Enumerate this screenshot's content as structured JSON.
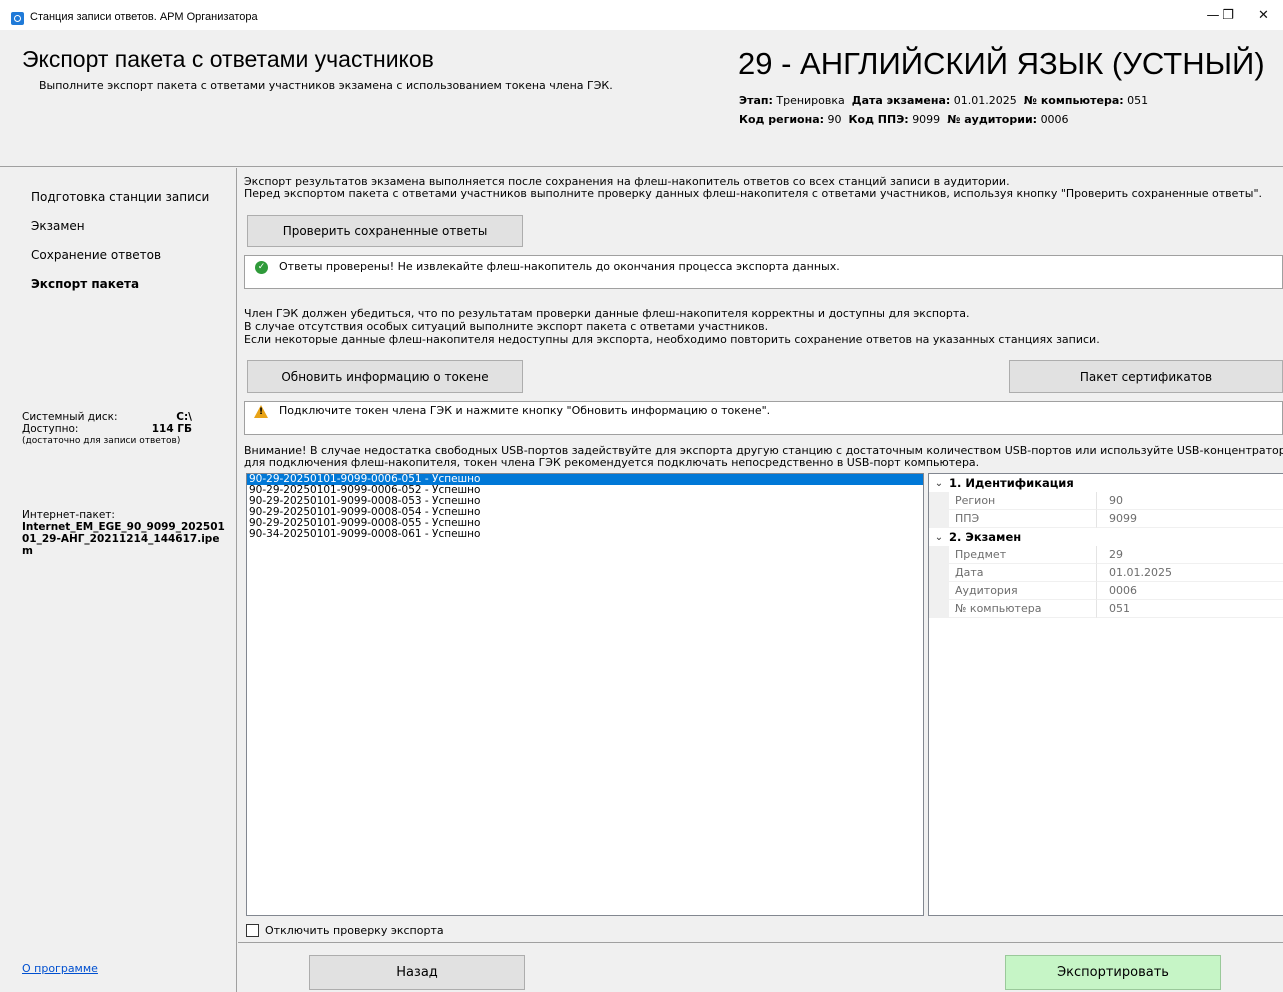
{
  "window": {
    "title": "Станция записи ответов. АРМ Организатора",
    "minimize_glyph": "—",
    "maximize_glyph": "❐",
    "close_glyph": "✕"
  },
  "header": {
    "title": "Экспорт пакета с ответами участников",
    "subtitle": "Выполните экспорт пакета с ответами участников экзамена с использованием токена члена ГЭК.",
    "subject": "29 - АНГЛИЙСКИЙ ЯЗЫК (УСТНЫЙ)",
    "stage_label": "Этап:",
    "stage_value": "Тренировка",
    "exam_date_label": "Дата экзамена:",
    "exam_date_value": "01.01.2025",
    "computer_label": "№ компьютера:",
    "computer_value": "051",
    "region_label": "Код региона:",
    "region_value": "90",
    "ppe_label": "Код ППЭ:",
    "ppe_value": "9099",
    "room_label": "№ аудитории:",
    "room_value": "0006"
  },
  "nav": {
    "items": [
      {
        "label": "Подготовка станции записи",
        "active": false
      },
      {
        "label": "Экзамен",
        "active": false
      },
      {
        "label": "Сохранение ответов",
        "active": false
      },
      {
        "label": "Экспорт пакета",
        "active": true
      }
    ]
  },
  "system": {
    "disk_label": "Системный диск:",
    "disk_value": "C:\\",
    "free_label": "Доступно:",
    "free_value": "114 ГБ",
    "free_note": "(достаточно для записи ответов)",
    "package_label": "Интернет-пакет:",
    "package_value": "Internet_EM_EGE_90_9099_20250101_29-АНГ_20211214_144617.ipem",
    "about_link": "О программе"
  },
  "main": {
    "intro_line1": "Экспорт результатов экзамена выполняется после сохранения на флеш-накопитель ответов со всех станций записи в аудитории.",
    "intro_line2": "Перед экспортом пакета с ответами участников выполните проверку данных флеш-накопителя с ответами участников, используя кнопку \"Проверить сохраненные ответы\".",
    "check_button": "Проверить сохраненные ответы",
    "check_status": "Ответы проверены! Не извлекайте флеш-накопитель до окончания процесса экспорта данных.",
    "gek_line1": "Член ГЭК должен убедиться, что по результатам проверки данные флеш-накопителя корректны и доступны для экспорта.",
    "gek_line2": "В случае отсутствия особых ситуаций выполните экспорт пакета с ответами участников.",
    "gek_line3": "Если некоторые данные флеш-накопителя недоступны для экспорта, необходимо повторить сохранение ответов на указанных станциях записи.",
    "refresh_token_button": "Обновить информацию о токене",
    "certificates_button": "Пакет сертификатов",
    "token_status": "Подключите токен члена ГЭК и нажмите кнопку \"Обновить информацию о токене\".",
    "warning_line1": "Внимание! В случае недостатка свободных USB-портов задействуйте для экспорта другую станцию с достаточным количеством USB-портов или используйте USB-концентратор",
    "warning_line2": "для подключения флеш-накопителя, токен члена ГЭК рекомендуется подключать непосредственно в USB-порт компьютера.",
    "files": [
      "90-29-20250101-9099-0006-051 - Успешно",
      "90-29-20250101-9099-0006-052 - Успешно",
      "90-29-20250101-9099-0008-053 - Успешно",
      "90-29-20250101-9099-0008-054 - Успешно",
      "90-29-20250101-9099-0008-055 - Успешно",
      "90-34-20250101-9099-0008-061 - Успешно"
    ],
    "selected_file_index": 0,
    "properties": {
      "cat1": "1. Идентификация",
      "region_key": "Регион",
      "region_val": "90",
      "ppe_key": "ППЭ",
      "ppe_val": "9099",
      "cat2": "2. Экзамен",
      "subject_key": "Предмет",
      "subject_val": "29",
      "date_key": "Дата",
      "date_val": "01.01.2025",
      "room_key": "Аудитория",
      "room_val": "0006",
      "comp_key": "№ компьютера",
      "comp_val": "051"
    },
    "disable_check_label": "Отключить проверку экспорта",
    "back_button": "Назад",
    "export_button": "Экспортировать"
  },
  "colors": {
    "export_button_bg": "#c6f5c6",
    "selection": "#0078d7",
    "link": "#0050d0"
  }
}
